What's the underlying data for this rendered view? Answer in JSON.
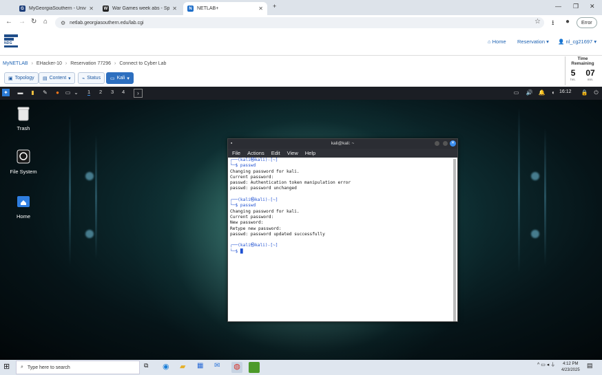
{
  "browser": {
    "tabs": [
      {
        "label": "MyGeorgiaSouthern - Universit",
        "active": false
      },
      {
        "label": "War Games week abs - Spring",
        "active": false
      },
      {
        "label": "NETLAB+",
        "active": true
      }
    ],
    "url": "netlab.georgiasouthern.edu/lab.cgi",
    "profile_chip": "Error"
  },
  "netlab": {
    "logo_text": "NDG",
    "home": "Home",
    "reservation": "Reservation",
    "user": "nl_cg21697",
    "breadcrumb": [
      "MyNETLAB",
      "EHacker-10",
      "Reservation 77296",
      "Connect to Cyber Lab"
    ],
    "time_remaining": {
      "title": "Time Remaining",
      "hours": "5",
      "minutes": "07",
      "hours_unit": "hrs.",
      "minutes_unit": "min."
    },
    "tabs": {
      "topology": "Topology",
      "content": "Content",
      "status": "Status",
      "kali": "Kali"
    }
  },
  "kali": {
    "workspaces": [
      "1",
      "2",
      "3",
      "4"
    ],
    "clock": "16:12",
    "desktop_icons": [
      {
        "label": "Trash",
        "icon": "trash-icon"
      },
      {
        "label": "File System",
        "icon": "drive-icon"
      },
      {
        "label": "Home",
        "icon": "home-folder-icon"
      }
    ],
    "terminal": {
      "title": "kali@kali: ~",
      "menu": [
        "File",
        "Actions",
        "Edit",
        "View",
        "Help"
      ],
      "lines": [
        {
          "t": "┌──(kali㉿kali)-[~]",
          "c": "blue"
        },
        {
          "t": "└─$ passwd",
          "c": "blue"
        },
        {
          "t": "Changing password for kali.",
          "c": ""
        },
        {
          "t": "Current password:",
          "c": ""
        },
        {
          "t": "passwd: Authentication token manipulation error",
          "c": ""
        },
        {
          "t": "passwd: password unchanged",
          "c": ""
        },
        {
          "t": "",
          "c": ""
        },
        {
          "t": "┌──(kali㉿kali)-[~]",
          "c": "blue"
        },
        {
          "t": "└─$ passwd",
          "c": "blue"
        },
        {
          "t": "Changing password for kali.",
          "c": ""
        },
        {
          "t": "Current password:",
          "c": ""
        },
        {
          "t": "New password:",
          "c": ""
        },
        {
          "t": "Retype new password:",
          "c": ""
        },
        {
          "t": "passwd: password updated successfully",
          "c": ""
        },
        {
          "t": "",
          "c": ""
        },
        {
          "t": "┌──(kali㉿kali)-[~]",
          "c": "blue"
        },
        {
          "t": "└─$ █",
          "c": "blue"
        }
      ]
    }
  },
  "taskbar": {
    "search_placeholder": "Type here to search",
    "time": "4:12 PM",
    "date": "4/23/2025"
  }
}
